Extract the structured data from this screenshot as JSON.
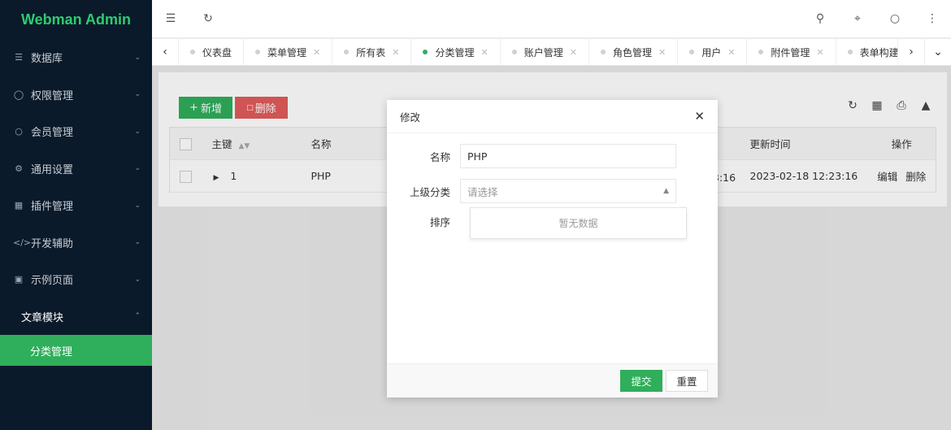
{
  "app": {
    "brand": "Webman Admin",
    "accent": "#2fae5b"
  },
  "sidebar": {
    "items": [
      {
        "label": "数据库",
        "icon": "stack-icon"
      },
      {
        "label": "权限管理",
        "icon": "shield-icon"
      },
      {
        "label": "会员管理",
        "icon": "user-icon"
      },
      {
        "label": "通用设置",
        "icon": "gear-icon"
      },
      {
        "label": "插件管理",
        "icon": "plugin-icon"
      },
      {
        "label": "开发辅助",
        "icon": "code-icon"
      },
      {
        "label": "示例页面",
        "icon": "page-icon"
      }
    ],
    "open_group": "文章模块",
    "open_child": "分类管理"
  },
  "tabs": [
    {
      "label": "仪表盘",
      "closable": false
    },
    {
      "label": "菜单管理",
      "closable": true
    },
    {
      "label": "所有表",
      "closable": true
    },
    {
      "label": "分类管理",
      "closable": true,
      "active": true
    },
    {
      "label": "账户管理",
      "closable": true
    },
    {
      "label": "角色管理",
      "closable": true
    },
    {
      "label": "用户",
      "closable": true
    },
    {
      "label": "附件管理",
      "closable": true
    },
    {
      "label": "表单构建",
      "closable": true
    }
  ],
  "toolbar": {
    "add_label": "新增",
    "delete_label": "删除"
  },
  "table": {
    "headers": {
      "id": "主键",
      "name": "名称",
      "updated": "更新时间",
      "actions": "操作"
    },
    "rows": [
      {
        "id": "1",
        "name": "PHP",
        "created_tail": "3:16",
        "updated": "2023-02-18 12:23:16",
        "edit": "编辑",
        "delete": "删除"
      }
    ]
  },
  "modal": {
    "title": "修改",
    "fields": {
      "name_label": "名称",
      "name_value": "PHP",
      "parent_label": "上级分类",
      "parent_placeholder": "请选择",
      "sort_label": "排序"
    },
    "dropdown_empty": "暂无数据",
    "submit_label": "提交",
    "reset_label": "重置"
  }
}
